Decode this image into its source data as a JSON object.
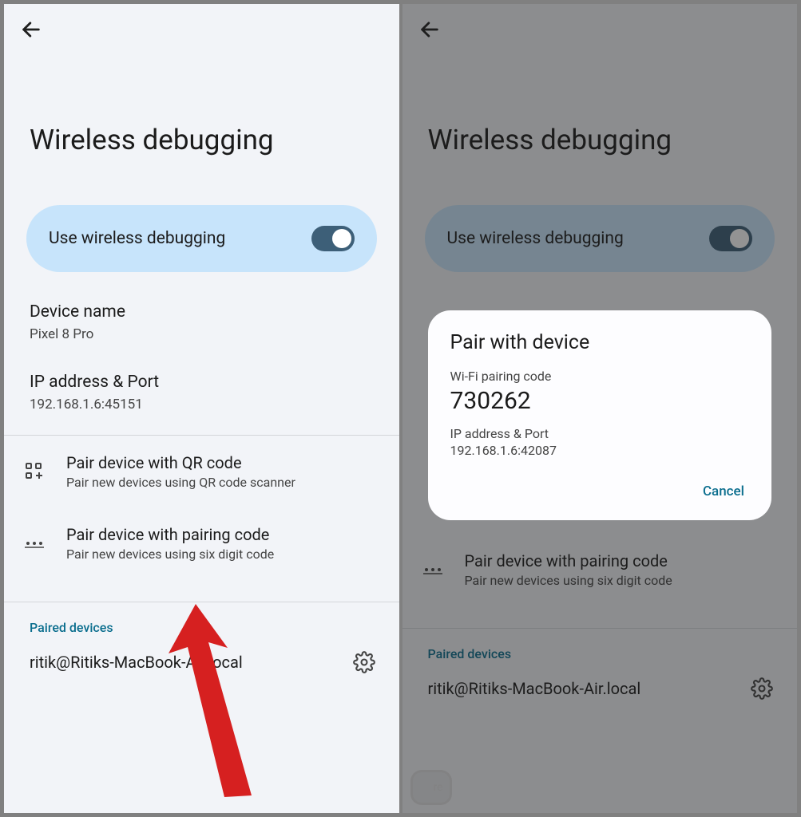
{
  "left": {
    "title": "Wireless debugging",
    "toggle_label": "Use wireless debugging",
    "device_name_label": "Device name",
    "device_name_value": "Pixel 8 Pro",
    "ip_label": "IP address & Port",
    "ip_value": "192.168.1.6:45151",
    "pair_qr_title": "Pair device with QR code",
    "pair_qr_sub": "Pair new devices using QR code scanner",
    "pair_code_title": "Pair device with pairing code",
    "pair_code_sub": "Pair new devices using six digit code",
    "paired_label": "Paired devices",
    "paired_device": "ritik@Ritiks-MacBook-Air.local"
  },
  "right": {
    "title": "Wireless debugging",
    "toggle_label": "Use wireless debugging",
    "pair_code_title": "Pair device with pairing code",
    "pair_code_sub": "Pair new devices using six digit code",
    "paired_label": "Paired devices",
    "paired_device": "ritik@Ritiks-MacBook-Air.local",
    "blurred_text": "re"
  },
  "dialog": {
    "title": "Pair with device",
    "code_label": "Wi-Fi pairing code",
    "code_value": "730262",
    "ip_label": "IP address & Port",
    "ip_value": "192.168.1.6:42087",
    "cancel": "Cancel"
  }
}
